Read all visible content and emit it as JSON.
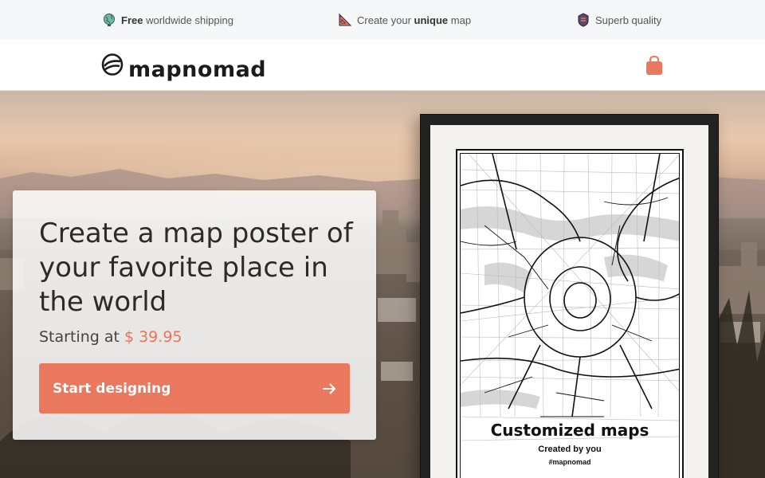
{
  "topbar": {
    "perks": [
      {
        "icon": "globe-icon",
        "bold": "Free",
        "after": " worldwide shipping"
      },
      {
        "icon": "ruler-icon",
        "before": "Create your ",
        "bold": "unique",
        "after": " map"
      },
      {
        "icon": "quality-badge-icon",
        "after": "Superb quality"
      }
    ]
  },
  "header": {
    "logo_text": "mapnomad",
    "cart_icon": "shopping-bag-icon"
  },
  "hero": {
    "headline": "Create a map poster of your favorite place in the world",
    "price_prefix": "Starting at ",
    "price_amount": "$ 39.95",
    "cta_label": "Start designing",
    "cta_icon": "arrow-right-icon"
  },
  "poster": {
    "title": "Customized maps",
    "subtitle": "Created by you",
    "tag": "#mapnomad"
  },
  "colors": {
    "accent": "#e9785e",
    "price": "#e8745a",
    "topbar_bg": "#f6f7f9"
  }
}
